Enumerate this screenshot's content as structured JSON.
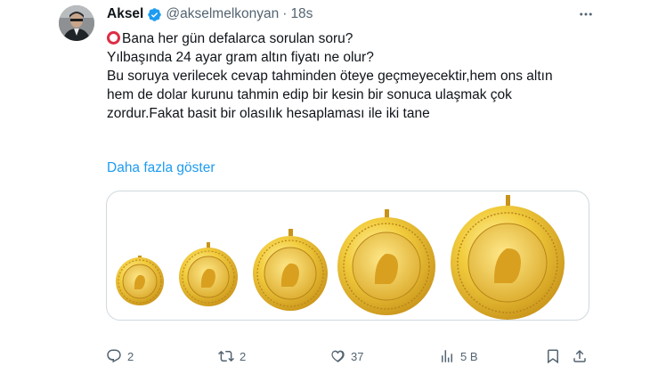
{
  "tweet": {
    "author": {
      "name": "Aksel",
      "handle": "@akselmelkonyan",
      "time": "18s",
      "verified": true
    },
    "text": {
      "line1": "Bana her gün defalarca sorulan soru?",
      "line2": "Yılbaşında 24 ayar gram altın fiyatı ne olur?",
      "line3": "Bu soruya verilecek cevap tahminden öteye geçmeyecektir,hem ons altın",
      "line4": "hem de dolar kurunu tahmin edip bir kesin bir sonuca ulaşmak çok",
      "line5": "zordur.Fakat basit bir olasılık hesaplaması ile iki tane"
    },
    "show_more": "Daha fazla göster",
    "media": {
      "description_icon": "gold-coins-image",
      "coins": 5
    },
    "actions": {
      "replies": "2",
      "retweets": "2",
      "likes": "37",
      "views": "5 B"
    }
  },
  "colors": {
    "accent": "#1d9bf0",
    "text": "#0f1419",
    "muted": "#536471",
    "border": "#cfd9de",
    "gold": "#e8b923",
    "emoji_red": "#dd2e44"
  }
}
